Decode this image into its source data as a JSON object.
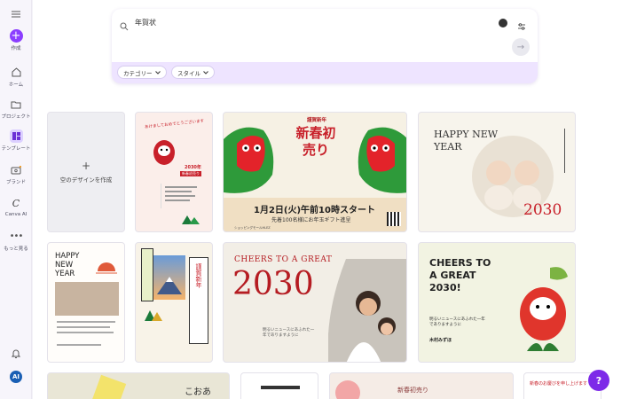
{
  "sidebar": {
    "items": [
      {
        "label": "作成"
      },
      {
        "label": "ホーム"
      },
      {
        "label": "プロジェクト"
      },
      {
        "label": "テンプレート"
      },
      {
        "label": "ブランド"
      },
      {
        "label": "Canva AI"
      },
      {
        "label": "もっと見る"
      }
    ],
    "avatar_initials": "AI"
  },
  "search": {
    "query": "年賀状",
    "submit_icon": "→",
    "filters": [
      {
        "label": "カテゴリー"
      },
      {
        "label": "スタイル"
      }
    ]
  },
  "cards": {
    "blank": {
      "plus": "+",
      "label": "空のデザインを作成"
    },
    "t1": {
      "headline": "あけましておめでとうございます",
      "year": "2030年",
      "subtitle": "新春初売り"
    },
    "t2": {
      "badge": "謹賀新年",
      "title": "新春初売り",
      "main": "1月2日(火)午前10時スタート",
      "sub": "先着100名様にお年玉ギフト進呈",
      "footer": "ショッピングモールHLEZ"
    },
    "t3": {
      "title_l1": "HAPPY NEW",
      "title_l2": "YEAR",
      "year": "2030",
      "vertical": "我が家に新しい家族が仲間入りしました"
    },
    "t4": {
      "title_l1": "HAPPY",
      "title_l2": "NEW",
      "title_l3": "YEAR"
    },
    "t5": {
      "label": "謹賀新年"
    },
    "t6": {
      "title": "CHEERS TO A GREAT",
      "year": "2030",
      "message": "明るいニュースにあふれた一年でありますように"
    },
    "t7": {
      "title_l1": "CHEERS TO",
      "title_l2": "A GREAT",
      "title_l3": "2030!",
      "message": "明るいニュースにあふれた一年でありますように",
      "name": "木村みずほ"
    },
    "t8": {
      "text": "こおあ"
    },
    "t10": {
      "title": "新春初売り"
    },
    "t11": {
      "title": "新春のお慶びを申し上げます"
    }
  },
  "help": {
    "label": "?"
  },
  "colors": {
    "accent": "#8b3dff",
    "search_panel": "#eee4ff",
    "red": "#c8202a"
  }
}
